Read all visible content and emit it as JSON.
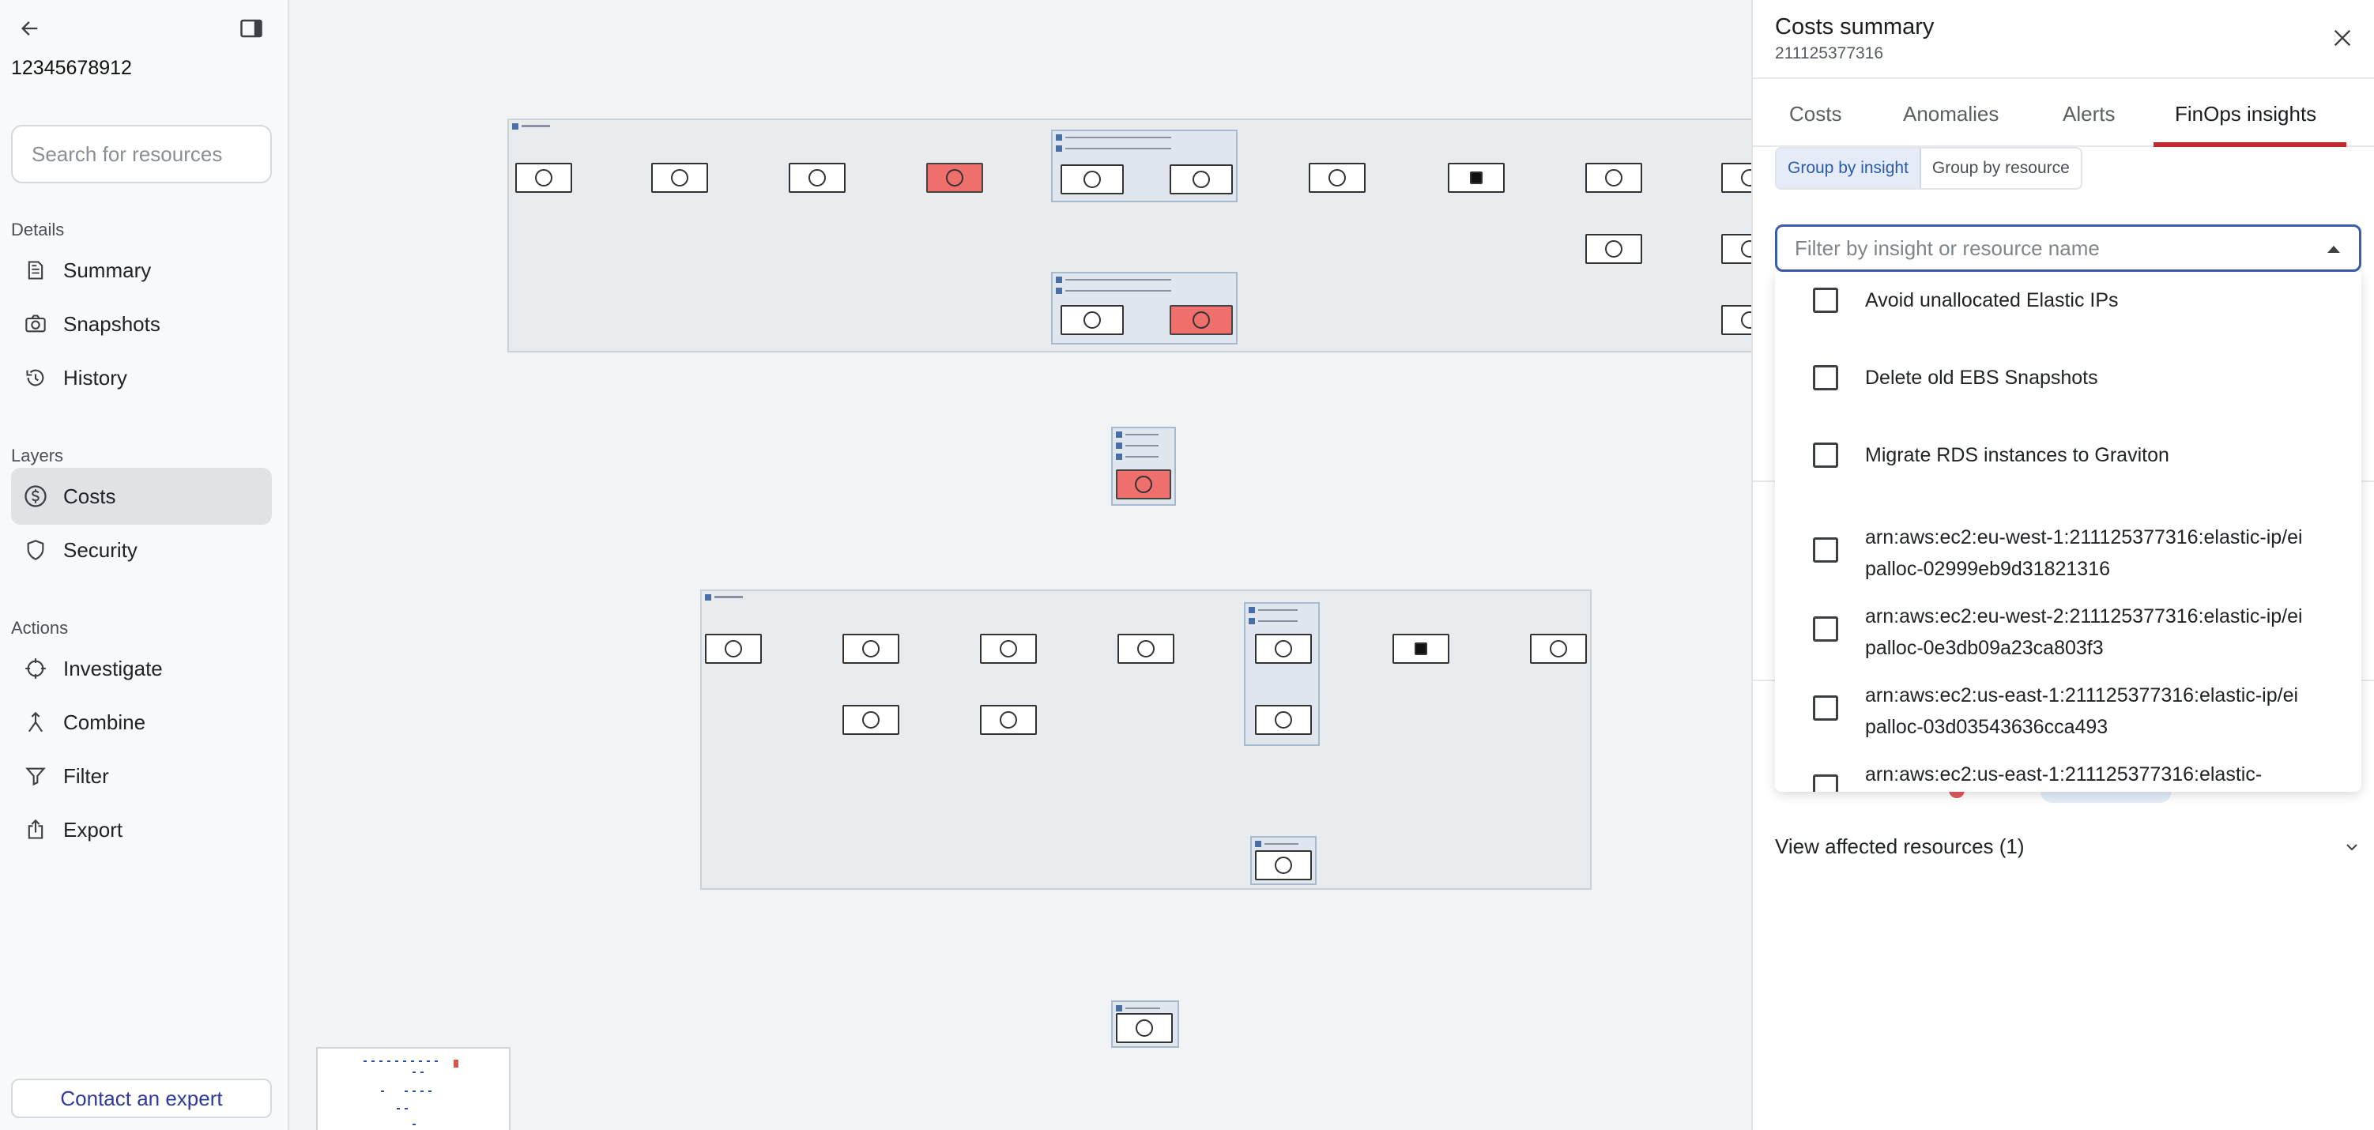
{
  "sidebar": {
    "account_id": "12345678912",
    "search": {
      "placeholder": "Search for resources"
    },
    "sections": {
      "details": "Details",
      "layers": "Layers",
      "actions": "Actions"
    },
    "details_items": [
      {
        "label": "Summary",
        "icon": "document-icon"
      },
      {
        "label": "Snapshots",
        "icon": "camera-icon"
      },
      {
        "label": "History",
        "icon": "history-icon"
      }
    ],
    "layer_items": [
      {
        "label": "Costs",
        "icon": "dollar-circle-icon",
        "active": true
      },
      {
        "label": "Security",
        "icon": "shield-icon",
        "active": false
      }
    ],
    "action_items": [
      {
        "label": "Investigate",
        "icon": "crosshair-icon"
      },
      {
        "label": "Combine",
        "icon": "merge-icon"
      },
      {
        "label": "Filter",
        "icon": "funnel-icon"
      },
      {
        "label": "Export",
        "icon": "share-icon"
      }
    ],
    "contact_label": "Contact an expert"
  },
  "panel": {
    "title": "Costs summary",
    "subtitle": "211125377316",
    "tabs": [
      "Costs",
      "Anomalies",
      "Alerts",
      "FinOps insights"
    ],
    "active_tab": "FinOps insights",
    "group_toggle": [
      "Group by insight",
      "Group by resource"
    ],
    "active_group": "Group by insight",
    "filter": {
      "placeholder": "Filter by insight or resource name",
      "value": ""
    },
    "options": [
      {
        "label": "Avoid unallocated Elastic IPs",
        "checked": false
      },
      {
        "label": "Delete old EBS Snapshots",
        "checked": false
      },
      {
        "label": "Migrate RDS instances to Graviton",
        "checked": false
      },
      {
        "label": "arn:aws:ec2:eu-west-1:211125377316:elastic-ip/eipalloc-02999eb9d31821316",
        "checked": false
      },
      {
        "label": "arn:aws:ec2:eu-west-2:211125377316:elastic-ip/eipalloc-0e3db09a23ca803f3",
        "checked": false
      },
      {
        "label": "arn:aws:ec2:us-east-1:211125377316:elastic-ip/eipalloc-03d03543636cca493",
        "checked": false
      },
      {
        "label": "arn:aws:ec2:us-east-1:211125377316:elastic-",
        "checked": false
      }
    ],
    "view_affected": "View affected resources (1)"
  },
  "colors": {
    "accent_red": "#c2282c",
    "toggle_blue": "#2b5aa8",
    "focus_border": "#3a5bb0",
    "node_red": "#ef6f6c",
    "edge_red": "#d9534f",
    "edge_green": "#3d9a5b",
    "edge_blue": "#3a5bd0",
    "contact_text": "#2d3a9c"
  }
}
